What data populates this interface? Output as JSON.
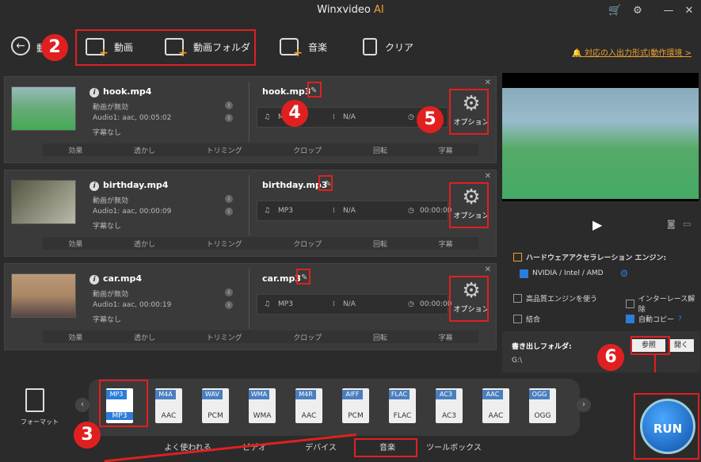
{
  "title": {
    "main": "Winxvideo",
    "ai": "AI"
  },
  "toolbar": {
    "back_partial": "動",
    "video": "動画",
    "folder": "動画フォルダ",
    "music": "音楽",
    "clear": "クリア",
    "support": "対応の入出力形式|動作環境 >"
  },
  "items": [
    {
      "name": "hook.mp4",
      "video": "動画が無効",
      "audio": "Audio1: aac, 00:05:02",
      "sub": "字幕なし",
      "out": "hook.mp3",
      "fmt": "MP3",
      "res": "N/A",
      "dur": "",
      "opt": "オプション"
    },
    {
      "name": "birthday.mp4",
      "video": "動画が無効",
      "audio": "Audio1: aac, 00:00:09",
      "sub": "字幕なし",
      "out": "birthday.mp3",
      "fmt": "MP3",
      "res": "N/A",
      "dur": "00:00:00",
      "opt": "オプション"
    },
    {
      "name": "car.mp4",
      "video": "動画が無効",
      "audio": "Audio1: aac, 00:00:19",
      "sub": "字幕なし",
      "out": "car.mp3",
      "fmt": "MP3",
      "res": "N/A",
      "dur": "00:00:00",
      "opt": "オプション"
    }
  ],
  "editbar": [
    "効果",
    "透かし",
    "トリミング",
    "クロップ",
    "回転",
    "字幕"
  ],
  "settings": {
    "hw": "ハードウェアアクセラレーション エンジン:",
    "gpu": "NVIDIA / Intel / AMD",
    "hq": "高品質エンジンを使う",
    "deint": "インターレース解除",
    "merge": "結合",
    "autocopy": "自動コピー",
    "help": "?",
    "out_label": "書き出しフォルダ:",
    "out_path": "G:\\",
    "browse": "参照",
    "open": "開く"
  },
  "format_label": "フォーマット",
  "formats": [
    {
      "top": "MP3",
      "bot": "MP3"
    },
    {
      "top": "M4A",
      "bot": "AAC"
    },
    {
      "top": "WAV",
      "bot": "PCM"
    },
    {
      "top": "WMA",
      "bot": "WMA"
    },
    {
      "top": "M4R",
      "bot": "AAC"
    },
    {
      "top": "AIFF",
      "bot": "PCM"
    },
    {
      "top": "FLAC",
      "bot": "FLAC"
    },
    {
      "top": "AC3",
      "bot": "AC3"
    },
    {
      "top": "AAC",
      "bot": "AAC"
    },
    {
      "top": "OGG",
      "bot": "OGG"
    }
  ],
  "tabs": [
    "よく使われる",
    "ビデオ",
    "デバイス",
    "音楽",
    "ツールボックス"
  ],
  "run": "RUN",
  "badges": [
    "2",
    "3",
    "4",
    "5",
    "6"
  ]
}
